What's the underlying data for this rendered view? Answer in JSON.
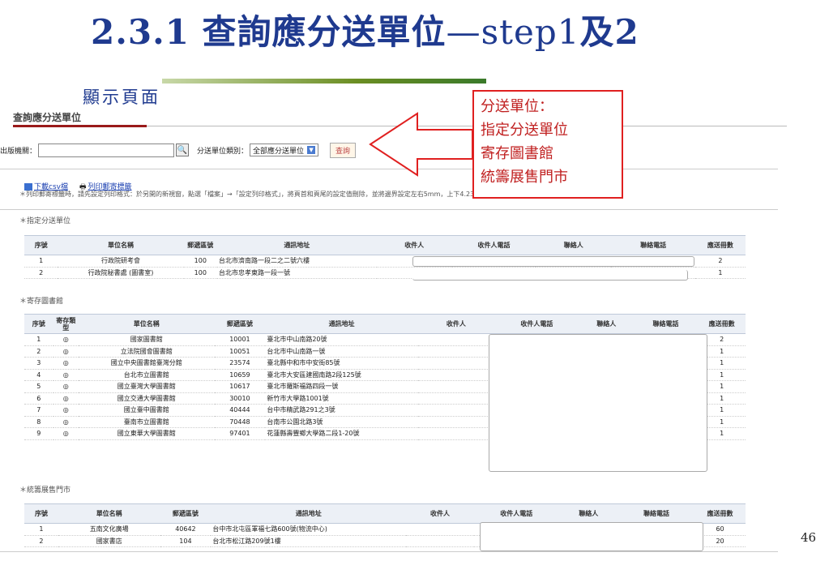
{
  "slide": {
    "title_prefix": "2.3.1 ",
    "title_main": "查詢應分送單位",
    "title_dash": "—",
    "title_latin": "step1",
    "title_tail": "及2",
    "subtitle": "顯示頁面",
    "page_number": "46"
  },
  "callout": {
    "lines": [
      "分送單位：",
      "指定分送單位",
      "寄存圖書館",
      "統籌展售門市"
    ],
    "color": "#e02020"
  },
  "page": {
    "heading": "查詢應分送單位",
    "search": {
      "publisher_label": "出版機關：",
      "publisher_value": "",
      "search_icon": "magnifier-icon",
      "type_label": "分送單位類別：",
      "type_value": "全部應分送單位",
      "query_button": "查詢"
    },
    "download_csv": "下載csv檔",
    "print_labels": "列印郵寄標籤",
    "print_note": "＊列印郵寄標籤時，請先設定列印格式：於另開的新視窗，點選「檔案」→「設定列印格式」，將頁首和頁尾的設定值刪除，並將邊界設定左右5mm，上下4.23mm"
  },
  "designated": {
    "section": "＊指定分送單位",
    "headers": [
      "序號",
      "單位名稱",
      "郵遞區號",
      "通訊地址",
      "收件人",
      "收件人電話",
      "聯絡人",
      "聯絡電話",
      "應送冊數"
    ],
    "rows": [
      [
        "1",
        "行政院研考會",
        "100",
        "台北市濟南路一段二之二號六樓",
        "2"
      ],
      [
        "2",
        "行政院秘書處 (圖書室)",
        "100",
        "台北市忠孝東路一段一號",
        "1"
      ]
    ]
  },
  "depository": {
    "section": "＊寄存圖書館",
    "headers": [
      "序號",
      "寄存類型",
      "單位名稱",
      "郵遞區號",
      "通訊地址",
      "收件人",
      "收件人電話",
      "聯絡人",
      "聯絡電話",
      "應送冊數"
    ],
    "rows": [
      [
        "1",
        "◎",
        "國家圖書館",
        "10001",
        "臺北市中山南路20號",
        "2"
      ],
      [
        "2",
        "◎",
        "立法院國會圖書館",
        "10051",
        "台北市中山南路一號",
        "1"
      ],
      [
        "3",
        "◎",
        "國立中央圖書館臺灣分館",
        "23574",
        "臺北縣中和市中安街85號",
        "1"
      ],
      [
        "4",
        "◎",
        "台北市立圖書館",
        "10659",
        "臺北市大安區建國南路2段125號",
        "1"
      ],
      [
        "5",
        "◎",
        "國立臺灣大學圖書館",
        "10617",
        "臺北市羅斯福路四段一號",
        "1"
      ],
      [
        "6",
        "◎",
        "國立交通大學圖書館",
        "30010",
        "新竹市大學路1001號",
        "1"
      ],
      [
        "7",
        "◎",
        "國立臺中圖書館",
        "40444",
        "台中市精武路291之3號",
        "1"
      ],
      [
        "8",
        "◎",
        "臺南市立圖書館",
        "70448",
        "台南市公園北路3號",
        "1"
      ],
      [
        "9",
        "◎",
        "國立東華大學圖書館",
        "97401",
        "花蓮縣壽豐鄉大學路二段1-20號",
        "1"
      ]
    ]
  },
  "outlets": {
    "section": "＊統籌展售門市",
    "headers": [
      "序號",
      "單位名稱",
      "郵遞區號",
      "通訊地址",
      "收件人",
      "收件人電話",
      "聯絡人",
      "聯絡電話",
      "應送冊數"
    ],
    "rows": [
      [
        "1",
        "五南文化廣場",
        "40642",
        "台中市北屯區軍福七路600號(物流中心)",
        "60"
      ],
      [
        "2",
        "國家書店",
        "104",
        "台北市松江路209號1樓",
        "20"
      ]
    ]
  }
}
